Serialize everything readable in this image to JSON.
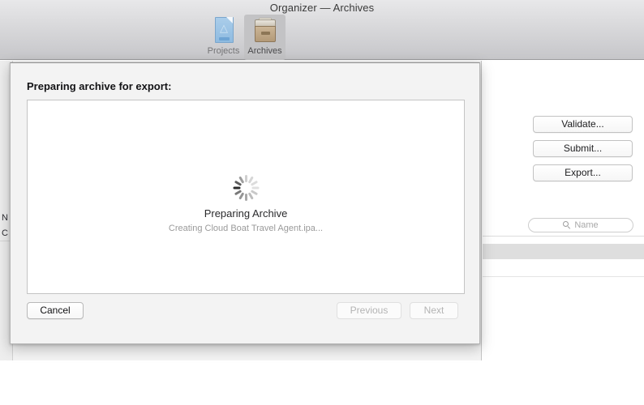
{
  "window": {
    "title": "Organizer — Archives",
    "toolbar": [
      {
        "label": "Projects",
        "icon": "projects-document-icon",
        "selected": false
      },
      {
        "label": "Archives",
        "icon": "archives-box-icon",
        "selected": true
      }
    ]
  },
  "left_pane": {
    "partial_rows": [
      "N",
      "C"
    ]
  },
  "right_pane": {
    "actions": [
      {
        "label": "Validate..."
      },
      {
        "label": "Submit..."
      },
      {
        "label": "Export..."
      }
    ],
    "search": {
      "icon": "search-icon",
      "placeholder": "Name",
      "value": ""
    }
  },
  "sheet": {
    "heading": "Preparing archive for export:",
    "progress": {
      "spinner": "indeterminate-spinner",
      "title": "Preparing Archive",
      "detail": "Creating Cloud Boat Travel Agent.ipa..."
    },
    "buttons": {
      "cancel": {
        "label": "Cancel",
        "enabled": true
      },
      "previous": {
        "label": "Previous",
        "enabled": false
      },
      "next": {
        "label": "Next",
        "enabled": false
      }
    }
  },
  "colors": {
    "titlebar_top": "#e8e8ea",
    "titlebar_bottom": "#c6c6c9",
    "sheet_background": "#f3f3f3",
    "content_background": "#ffffff",
    "disabled_text": "#b4b4b4",
    "detail_text": "#9a9a9a",
    "table_header_band": "#dedede"
  }
}
